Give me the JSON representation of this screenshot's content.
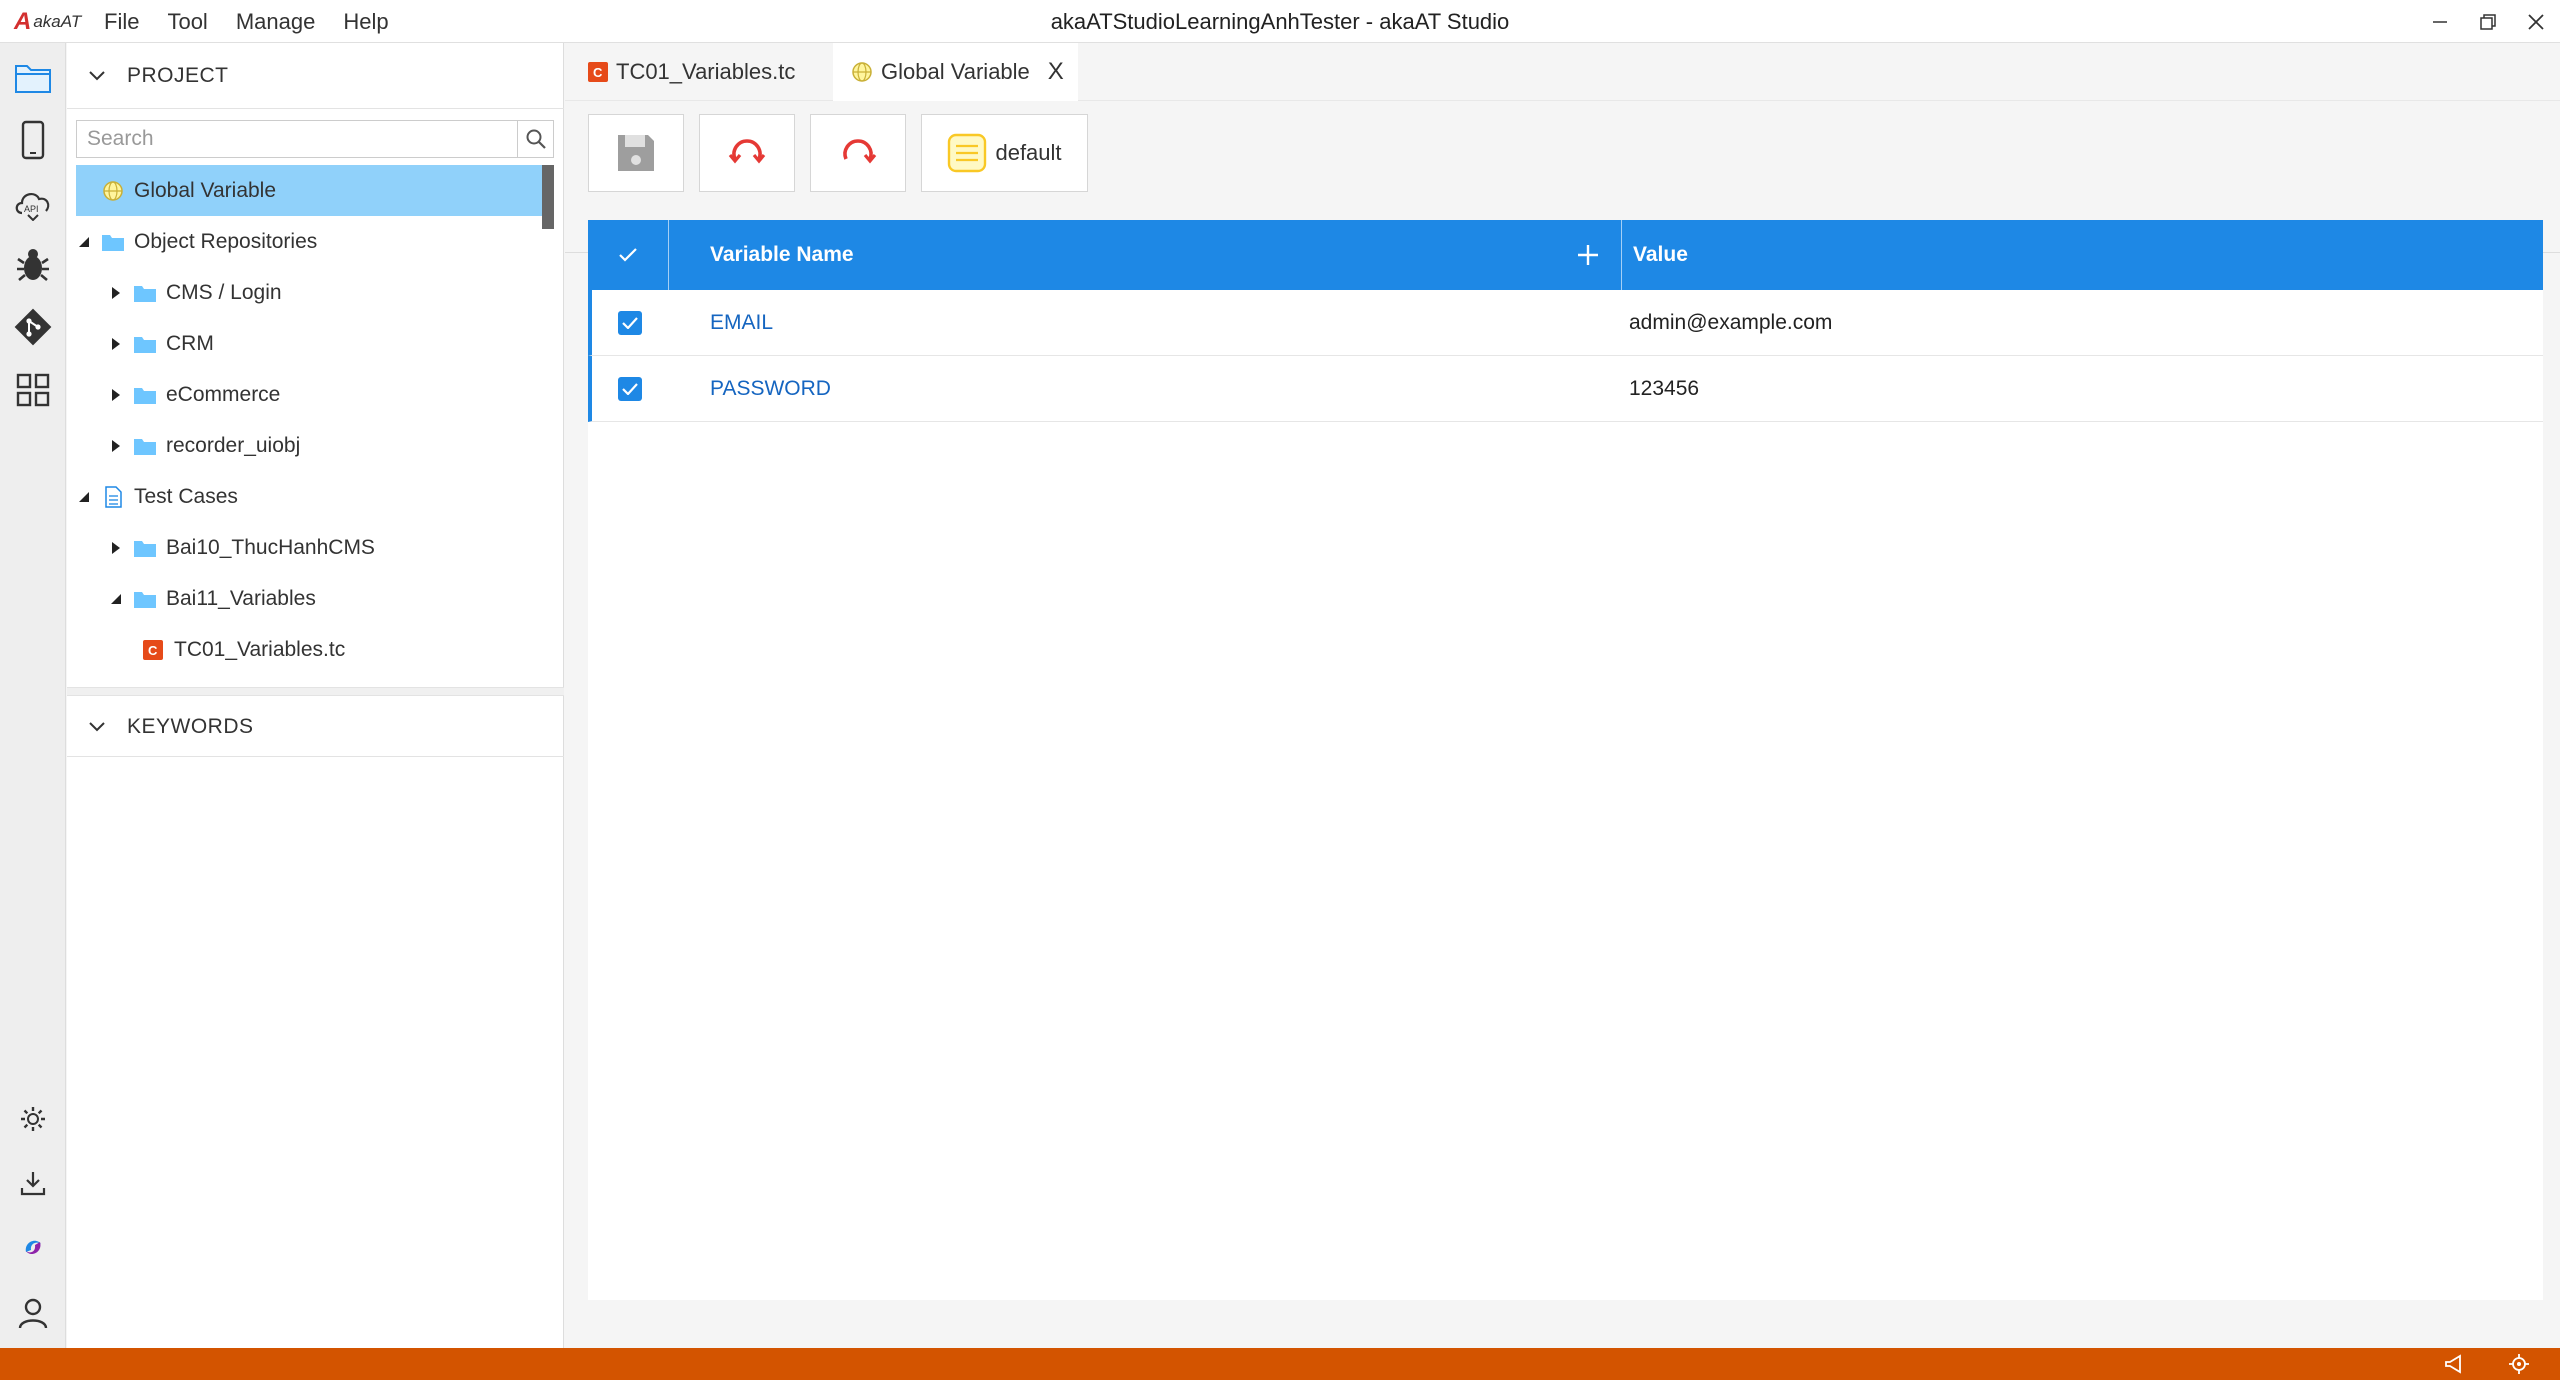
{
  "app": {
    "logo_text": "akaAT",
    "window_title": "akaATStudioLearningAnhTester - akaAT Studio",
    "menu": [
      "File",
      "Tool",
      "Manage",
      "Help"
    ]
  },
  "sidebar": {
    "project_header": "PROJECT",
    "search_placeholder": "Search",
    "tree": [
      {
        "label": "Global Variable"
      },
      {
        "label": "Object Repositories"
      },
      {
        "label": "CMS / Login"
      },
      {
        "label": "CRM"
      },
      {
        "label": "eCommerce"
      },
      {
        "label": "recorder_uiobj"
      },
      {
        "label": "Test Cases"
      },
      {
        "label": "Bai10_ThucHanhCMS"
      },
      {
        "label": "Bai11_Variables"
      },
      {
        "label": "TC01_Variables.tc"
      }
    ],
    "keywords_header": "KEYWORDS"
  },
  "editor": {
    "tabs": [
      {
        "label": "TC01_Variables.tc"
      },
      {
        "label": "Global Variable",
        "close": "X"
      }
    ],
    "toolbar": {
      "profile_label": "default"
    },
    "grid": {
      "columns": [
        "Variable Name",
        "Value"
      ],
      "rows": [
        {
          "name": "EMAIL",
          "value": "admin@example.com"
        },
        {
          "name": "PASSWORD",
          "value": "123456"
        }
      ]
    }
  },
  "colors": {
    "accent": "#1e88e5",
    "selection": "#90d1fa",
    "statusbar": "#d35400",
    "refresh": "#e53935"
  }
}
